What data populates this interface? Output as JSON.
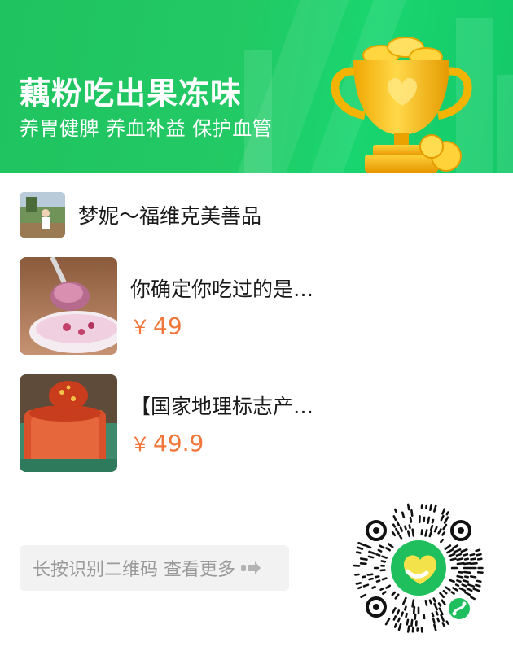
{
  "banner": {
    "title": "藕粉吃出果冻味",
    "subtitle": "养胃健脾 养血补益 保护血管"
  },
  "shop": {
    "name": "梦妮～福维克美善品"
  },
  "products": [
    {
      "title": "你确定你吃过的是…",
      "currency": "￥",
      "price": "49"
    },
    {
      "title": "【国家地理标志产…",
      "currency": "￥",
      "price": "49.9"
    }
  ],
  "footer": {
    "hint": "长按识别二维码 查看更多"
  },
  "colors": {
    "brand_green": "#1fc35f",
    "price_orange": "#f0763a",
    "gold": "#f7c21a"
  },
  "icons": [
    "trophy-icon",
    "hand-pointer-icon",
    "mini-program-qr-code",
    "mini-program-logo-icon"
  ]
}
